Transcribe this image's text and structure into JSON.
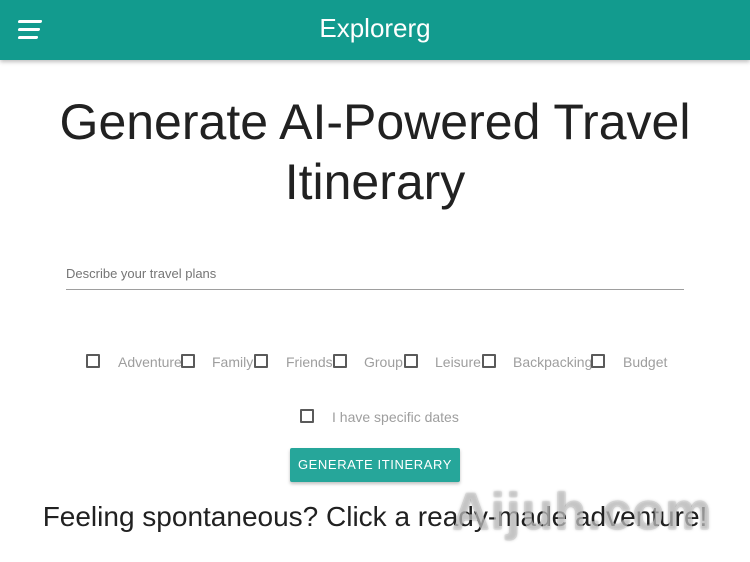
{
  "appbar": {
    "title": "Explorerg",
    "menu_icon": "hamburger-menu-icon",
    "color": "#129b8e"
  },
  "main": {
    "heading": "Generate AI-Powered Travel Itinerary",
    "input": {
      "placeholder": "Describe your travel plans",
      "value": ""
    },
    "categories": [
      {
        "label": "Adventure",
        "checked": false
      },
      {
        "label": "Family",
        "checked": false
      },
      {
        "label": "Friends",
        "checked": false
      },
      {
        "label": "Group",
        "checked": false
      },
      {
        "label": "Leisure",
        "checked": false
      },
      {
        "label": "Backpacking",
        "checked": false
      },
      {
        "label": "Budget",
        "checked": false
      }
    ],
    "specific_dates": {
      "label": "I have specific dates",
      "checked": false
    },
    "generate_button": "GENERATE ITINERARY",
    "spontaneous_text": "Feeling spontaneous? Click a ready-made adventure!",
    "button_color": "#26a69a"
  },
  "watermark": "Aijuh.com"
}
